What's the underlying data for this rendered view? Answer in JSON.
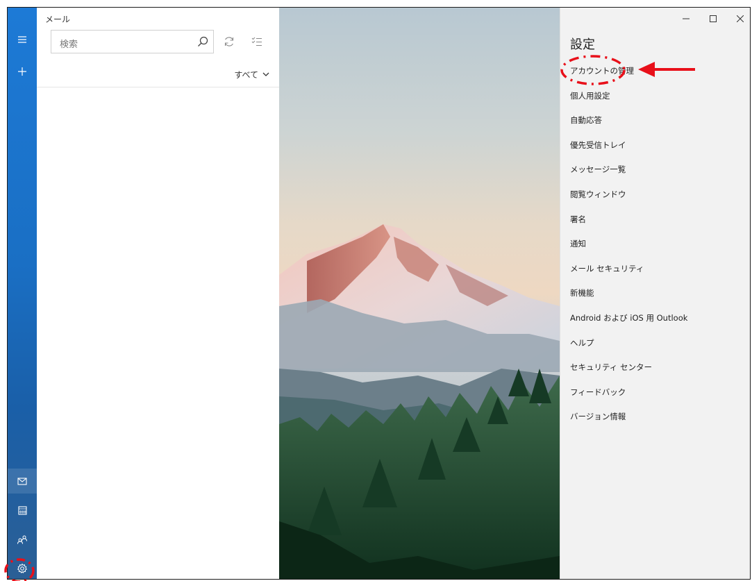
{
  "app": {
    "title": "メール"
  },
  "search": {
    "placeholder": "検索"
  },
  "filter": {
    "label": "すべて"
  },
  "nav": {
    "items": [
      {
        "icon": "hamburger-menu-icon"
      },
      {
        "icon": "plus-icon"
      },
      {
        "icon": "mail-icon"
      },
      {
        "icon": "calendar-icon"
      },
      {
        "icon": "people-icon"
      },
      {
        "icon": "gear-icon"
      }
    ]
  },
  "settings": {
    "title": "設定",
    "items": [
      "アカウントの管理",
      "個人用設定",
      "自動応答",
      "優先受信トレイ",
      "メッセージ一覧",
      "閲覧ウィンドウ",
      "署名",
      "通知",
      "メール セキュリティ",
      "新機能",
      "Android および iOS 用 Outlook",
      "ヘルプ",
      "セキュリティ センター",
      "フィードバック",
      "バージョン情報"
    ]
  },
  "window": {
    "minimize": "–",
    "maximize": "☐",
    "close": "✕"
  },
  "colors": {
    "accent": "#1a6fc4",
    "annotation": "#e8101a",
    "flyout_bg": "#f2f2f2"
  }
}
